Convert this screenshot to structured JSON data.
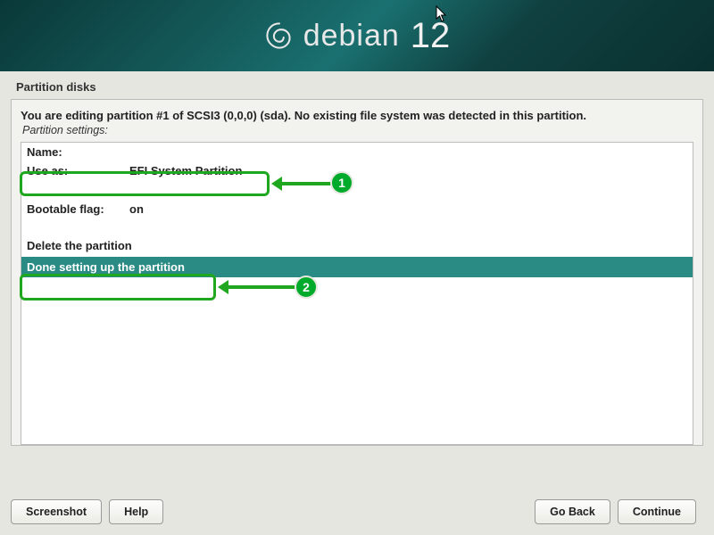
{
  "header": {
    "brand": "debian",
    "version": "12"
  },
  "page": {
    "title": "Partition disks",
    "instruction": "You are editing partition #1 of SCSI3 (0,0,0) (sda). No existing file system was detected in this partition.",
    "sub": "Partition settings:"
  },
  "settings": {
    "name_label": "Name:",
    "name_value": "",
    "use_as_label": "Use as:",
    "use_as_value": "EFI System Partition",
    "boot_label": "Bootable flag:",
    "boot_value": "on",
    "delete_label": "Delete the partition",
    "done_label": "Done setting up the partition"
  },
  "annotations": {
    "step1": "1",
    "step2": "2"
  },
  "footer": {
    "screenshot": "Screenshot",
    "help": "Help",
    "go_back": "Go Back",
    "continue": "Continue"
  }
}
